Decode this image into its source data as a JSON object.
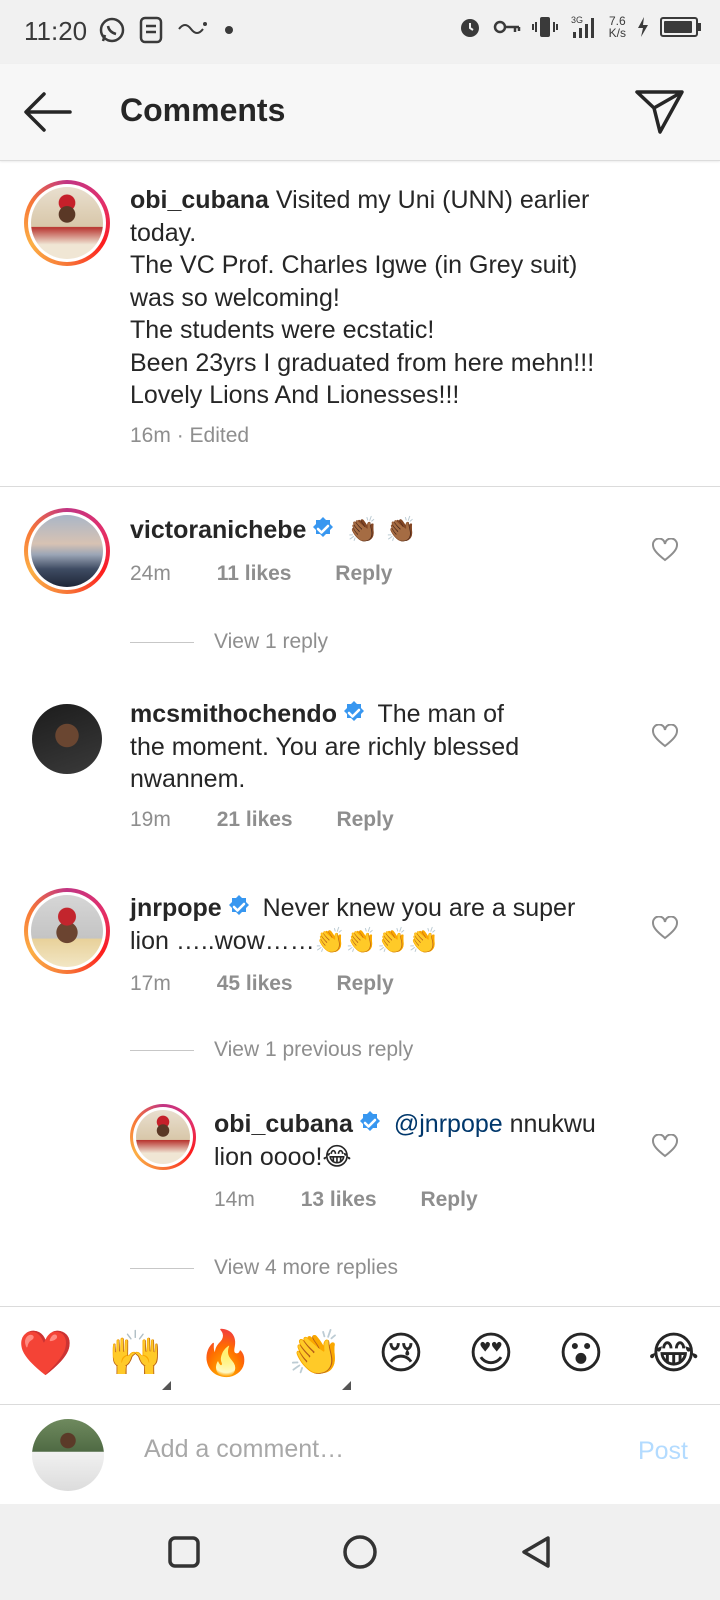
{
  "status_bar": {
    "time": "11:20",
    "net_speed_value": "7.6",
    "net_speed_unit": "K/s",
    "network_type": "3G"
  },
  "header": {
    "title": "Comments"
  },
  "caption": {
    "username": "obi_cubana",
    "text_lines": [
      "Visited my Uni (UNN) earlier",
      "today.",
      "The VC Prof. Charles Igwe (in Grey suit)",
      "was so welcoming!",
      "The students were ecstatic!",
      "Been 23yrs I graduated from here mehn!!!",
      "Lovely Lions And Lionesses!!!"
    ],
    "time": "16m",
    "edited": "· Edited"
  },
  "comments": [
    {
      "username": "victoranichebe",
      "text": "👏🏾 👏🏾",
      "time": "24m",
      "likes": "11 likes",
      "reply": "Reply",
      "view_replies": "View 1 reply"
    },
    {
      "username": "mcsmithochendo",
      "text_first": "The man of",
      "text_rest": [
        "the moment. You are richly blessed",
        "nwannem."
      ],
      "time": "19m",
      "likes": "21 likes",
      "reply": "Reply"
    },
    {
      "username": "jnrpope",
      "text_first": "Never knew you are a super",
      "text_rest": [
        "lion …..wow……👏👏👏👏"
      ],
      "time": "17m",
      "likes": "45 likes",
      "reply": "Reply",
      "view_replies": "View 1 previous reply",
      "replies": [
        {
          "username": "obi_cubana",
          "mention": "@jnrpope",
          "text_first": "nnukwu",
          "text_rest": [
            "lion oooo!😂"
          ],
          "time": "14m",
          "likes": "13 likes",
          "reply": "Reply"
        }
      ],
      "more_replies": "View 4 more replies"
    }
  ],
  "emoji_bar": [
    "❤️",
    "🙌",
    "🔥",
    "👏",
    "😢",
    "😍",
    "😮",
    "😂"
  ],
  "input": {
    "placeholder": "Add a comment…",
    "post_label": "Post"
  },
  "colors": {
    "verified": "#3897f0",
    "post_disabled": "#b3dbff",
    "mention": "#00376b",
    "meta": "#8e8e8e"
  }
}
